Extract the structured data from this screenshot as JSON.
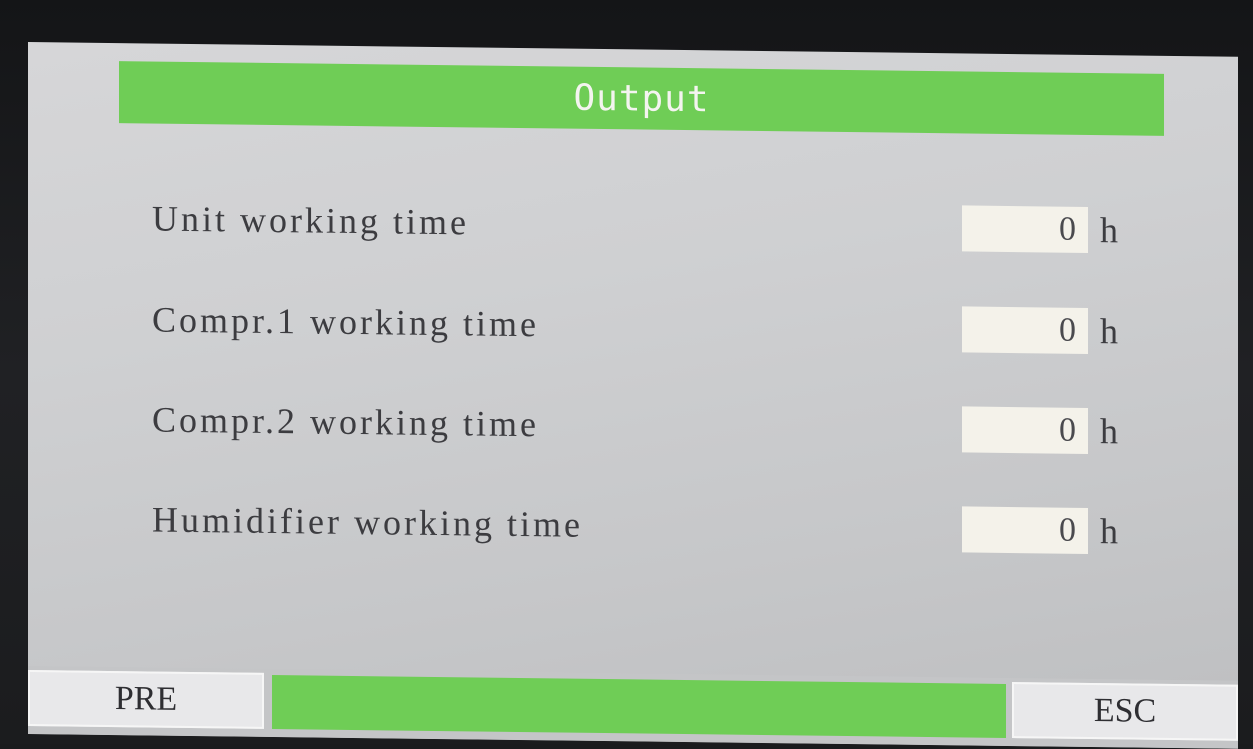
{
  "screen": {
    "title": "Output"
  },
  "rows": [
    {
      "label": "Unit working time",
      "value": "0",
      "unit": "h"
    },
    {
      "label": "Compr.1 working time",
      "value": "0",
      "unit": "h"
    },
    {
      "label": "Compr.2 working time",
      "value": "0",
      "unit": "h"
    },
    {
      "label": "Humidifier working time",
      "value": "0",
      "unit": "h"
    }
  ],
  "footer": {
    "pre_label": "PRE",
    "esc_label": "ESC"
  },
  "colors": {
    "accent_green": "#6fcd56",
    "screen_bg": "#cfd0d2",
    "value_box_bg": "#f4f2ea"
  }
}
